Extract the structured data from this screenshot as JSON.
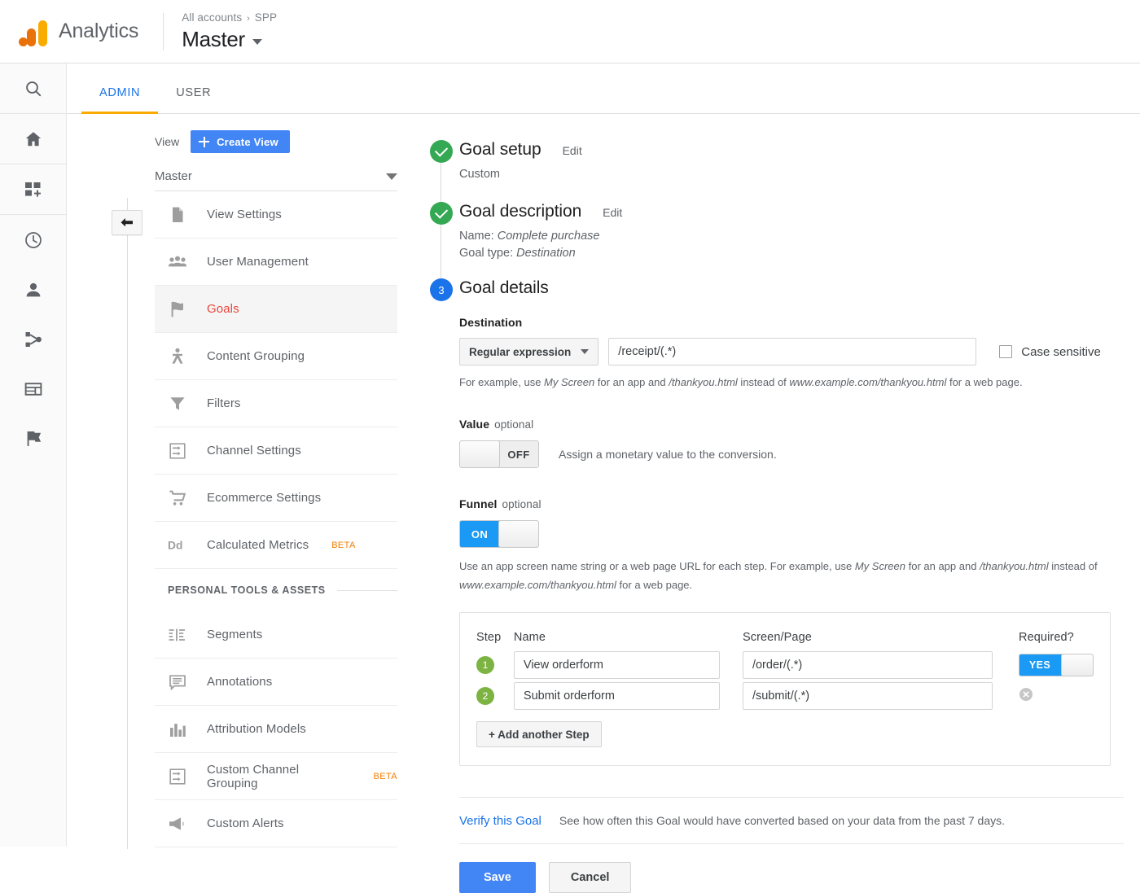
{
  "header": {
    "logo_icon": "google-analytics-logo",
    "brand": "Analytics",
    "breadcrumb_accounts": "All accounts",
    "breadcrumb_sep": "›",
    "breadcrumb_account": "SPP",
    "property": "Master"
  },
  "rail": {
    "items": [
      {
        "name": "search-icon"
      },
      {
        "name": "home-icon"
      },
      {
        "name": "customization-icon"
      },
      {
        "name": "realtime-clock-icon"
      },
      {
        "name": "audience-person-icon"
      },
      {
        "name": "acquisition-share-icon"
      },
      {
        "name": "behavior-window-icon"
      },
      {
        "name": "conversions-flag-icon"
      }
    ]
  },
  "tabs": [
    {
      "label": "ADMIN",
      "active": true
    },
    {
      "label": "USER",
      "active": false
    }
  ],
  "admin_nav": {
    "view_label": "View",
    "create_view_button": "Create View",
    "selected_view": "Master",
    "items": [
      {
        "label": "View Settings",
        "icon": "document-icon",
        "selected": false
      },
      {
        "label": "User Management",
        "icon": "people-icon",
        "selected": false
      },
      {
        "label": "Goals",
        "icon": "flag-icon",
        "selected": true
      },
      {
        "label": "Content Grouping",
        "icon": "content-grouping-icon",
        "selected": false
      },
      {
        "label": "Filters",
        "icon": "funnel-filter-icon",
        "selected": false
      },
      {
        "label": "Channel Settings",
        "icon": "channel-settings-icon",
        "selected": false
      },
      {
        "label": "Ecommerce Settings",
        "icon": "shopping-cart-icon",
        "selected": false
      },
      {
        "label": "Calculated Metrics",
        "icon": "dd-metrics-icon",
        "badge": "BETA",
        "selected": false
      }
    ],
    "personal_section_title": "PERSONAL TOOLS & ASSETS",
    "personal_items": [
      {
        "label": "Segments",
        "icon": "segments-icon"
      },
      {
        "label": "Annotations",
        "icon": "annotation-bubble-icon"
      },
      {
        "label": "Attribution Models",
        "icon": "bar-chart-icon"
      },
      {
        "label": "Custom Channel Grouping",
        "icon": "channel-settings-icon",
        "badge": "BETA"
      },
      {
        "label": "Custom Alerts",
        "icon": "megaphone-icon"
      }
    ],
    "collapse_icon": "collapse-left-arrow-icon"
  },
  "goal": {
    "step1": {
      "title": "Goal setup",
      "edit_label": "Edit",
      "value": "Custom",
      "status": "complete"
    },
    "step2": {
      "title": "Goal description",
      "edit_label": "Edit",
      "name_label": "Name:",
      "name_value": "Complete purchase",
      "type_label": "Goal type:",
      "type_value": "Destination",
      "status": "complete"
    },
    "step3": {
      "number": "3",
      "title": "Goal details",
      "destination": {
        "label": "Destination",
        "match_type": "Regular expression",
        "pattern": "/receipt/(.*)",
        "pattern_placeholder": "",
        "case_sensitive_label": "Case sensitive",
        "case_sensitive_checked": false,
        "hint_a": "For example, use ",
        "hint_i1": "My Screen",
        "hint_b": " for an app and ",
        "hint_i2": "/thankyou.html",
        "hint_c": " instead of ",
        "hint_i3": "www.example.com/thankyou.html",
        "hint_d": " for a web page."
      },
      "value": {
        "label": "Value",
        "optional": "optional",
        "toggle_state": "OFF",
        "description": "Assign a monetary value to the conversion."
      },
      "funnel": {
        "label": "Funnel",
        "optional": "optional",
        "toggle_state": "ON",
        "hint_a": "Use an app screen name string or a web page URL for each step. For example, use ",
        "hint_i1": "My Screen",
        "hint_b": " for an app and ",
        "hint_i2": "/thankyou.html",
        "hint_c": " instead of ",
        "hint_i3": "www.example.com/thankyou.html",
        "hint_d": " for a web page.",
        "columns": {
          "step": "Step",
          "name": "Name",
          "screen_page": "Screen/Page",
          "required": "Required?"
        },
        "steps": [
          {
            "num": "1",
            "name": "View orderform",
            "screen": "/order/(.*)",
            "required_toggle": "YES",
            "has_delete": false
          },
          {
            "num": "2",
            "name": "Submit orderform",
            "screen": "/submit/(.*)",
            "required_toggle": "",
            "has_delete": true
          }
        ],
        "add_step_button": "+ Add another Step"
      },
      "verify_link": "Verify this Goal",
      "verify_text": "See how often this Goal would have converted based on your data from the past 7 days.",
      "save_button": "Save",
      "cancel_button": "Cancel"
    }
  },
  "colors": {
    "accent_blue": "#4285f4",
    "link_blue": "#1a73e8",
    "toggle_on_blue": "#1a9af5",
    "complete_green": "#34a853",
    "step_badge_green": "#7cb342",
    "selected_red": "#e8453c",
    "beta_orange": "#f57c00",
    "tab_underline_orange": "#f9ab00",
    "logo_orange_dark": "#e8710a",
    "logo_orange_light": "#f9ab00"
  }
}
